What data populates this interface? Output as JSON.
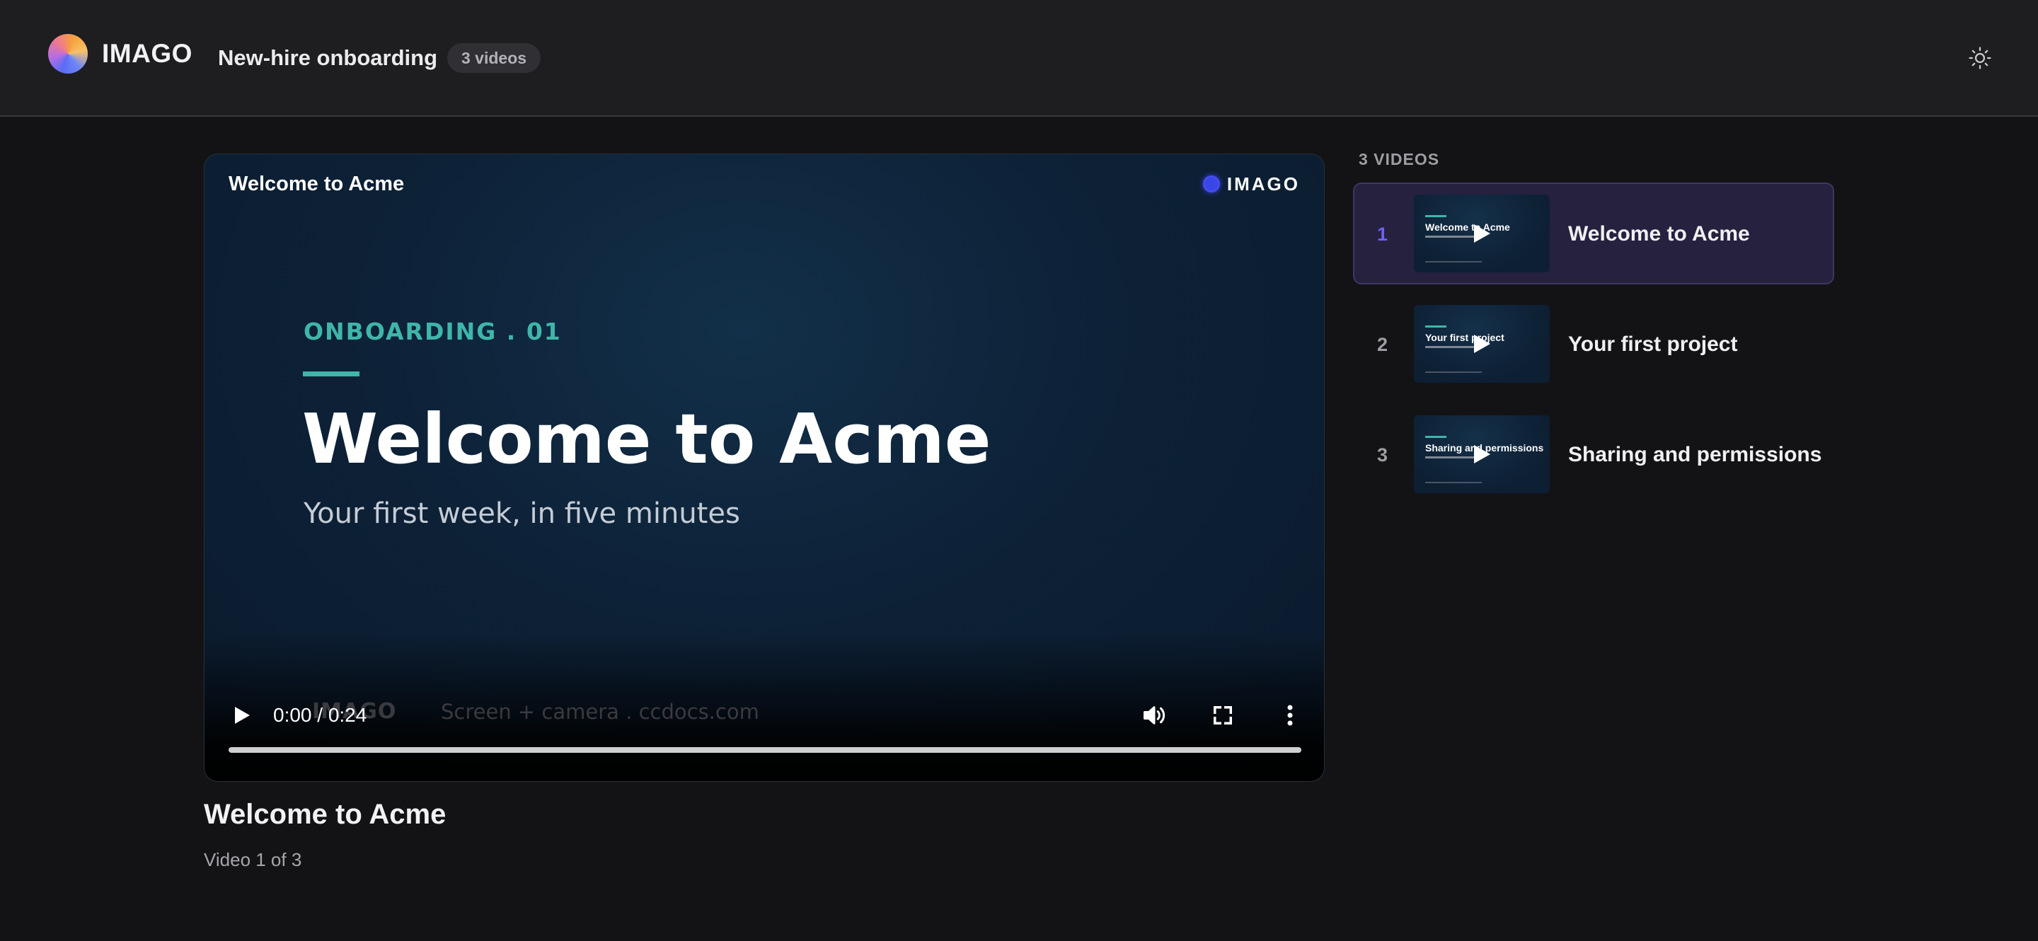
{
  "header": {
    "logo_text": "IMAGO",
    "collection_title": "New-hire onboarding",
    "video_count": "3 videos",
    "icons": {
      "logo": "gradient-circle-logo",
      "theme": "sun-icon"
    }
  },
  "player": {
    "overlay_title": "Welcome to Acme",
    "overlay_brand": "IMAGO",
    "slide": {
      "kicker": "ONBOARDING . 01",
      "title": "Welcome to Acme",
      "subtitle": "Your first week, in five minutes",
      "footer_brand": "IMAGO",
      "footer_credit": "Screen + camera . ccdocs.com"
    },
    "time": "0:00 / 0:24",
    "progress": 0,
    "controls": {
      "play": "play-icon",
      "volume": "volume-icon",
      "fullscreen": "fullscreen-icon",
      "menu": "more-vertical-icon"
    }
  },
  "now_playing": {
    "title": "Welcome to Acme",
    "subtitle": "Video 1 of 3"
  },
  "playlist": {
    "heading": "3 VIDEOS",
    "items": [
      {
        "number": "1",
        "label": "Welcome to Acme",
        "thumb_title": "Welcome to Acme",
        "active": true
      },
      {
        "number": "2",
        "label": "Your first project",
        "thumb_title": "Your first project",
        "active": false
      },
      {
        "number": "3",
        "label": "Sharing and permissions",
        "thumb_title": "Sharing and permissions",
        "active": false
      }
    ]
  },
  "colors": {
    "accent": "#6d63f0",
    "teal": "#3fb6a8",
    "active_row": "#25213f",
    "header_bg": "#1e1e21",
    "page_bg": "#131315"
  }
}
